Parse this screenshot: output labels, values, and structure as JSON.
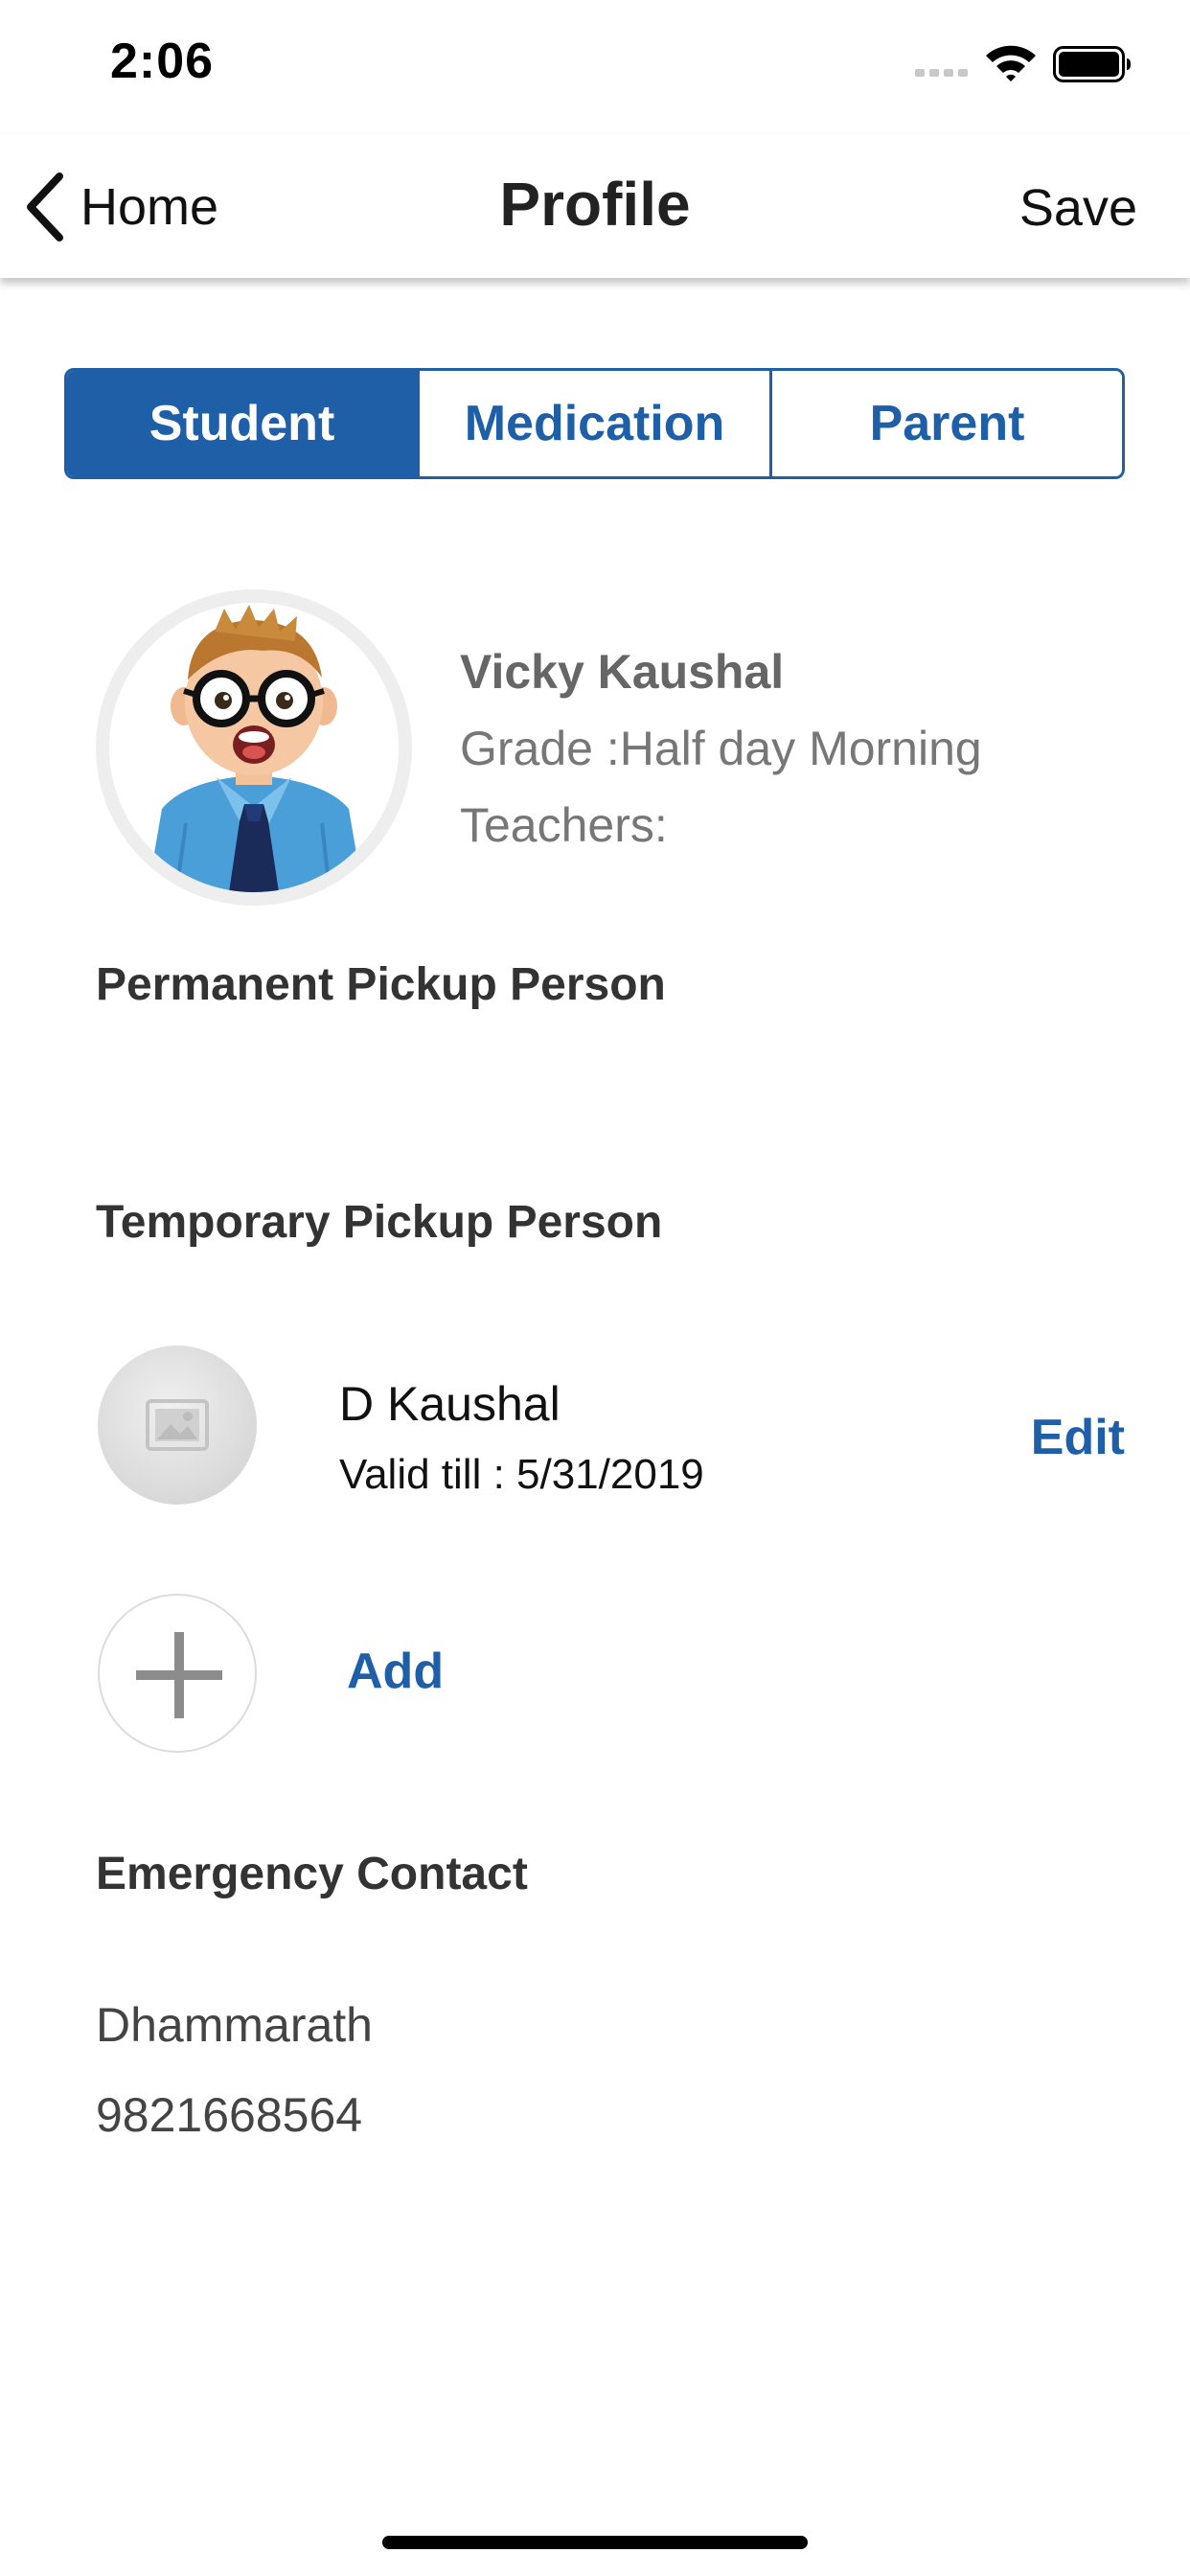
{
  "status_bar": {
    "time": "2:06"
  },
  "nav": {
    "back_label": "Home",
    "title": "Profile",
    "save_label": "Save"
  },
  "tabs": [
    {
      "label": "Student",
      "active": true
    },
    {
      "label": "Medication",
      "active": false
    },
    {
      "label": "Parent",
      "active": false
    }
  ],
  "student": {
    "name": "Vicky Kaushal",
    "grade": "Grade :Half day Morning",
    "teachers": "Teachers:"
  },
  "sections": {
    "permanent_pickup": "Permanent Pickup Person",
    "temporary_pickup": "Temporary Pickup Person",
    "emergency_contact": "Emergency Contact"
  },
  "temporary_pickup_person": {
    "name": "D Kaushal",
    "valid_till": "Valid till : 5/31/2019",
    "edit_label": "Edit"
  },
  "add_label": "Add",
  "emergency_contact": {
    "name": "Dhammarath",
    "phone": "9821668564"
  },
  "colors": {
    "accent": "#1f5fa8"
  },
  "icons": [
    "signal-icon",
    "wifi-icon",
    "battery-icon",
    "back-chevron-icon",
    "image-placeholder-icon",
    "plus-icon"
  ]
}
